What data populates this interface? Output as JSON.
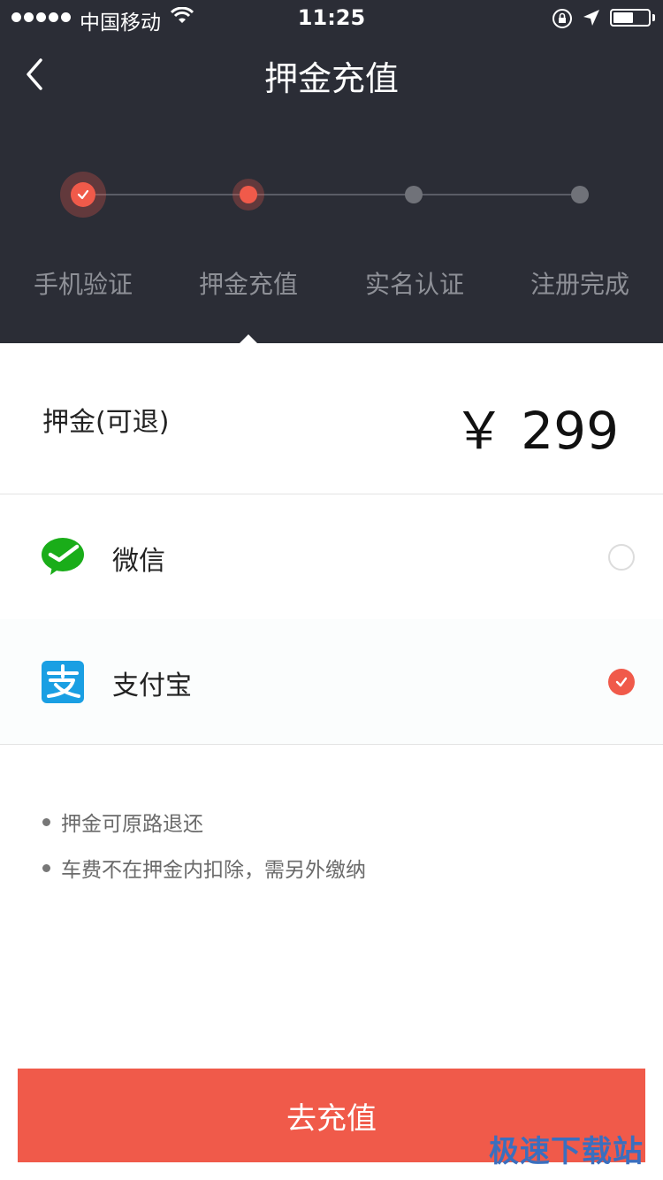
{
  "status_bar": {
    "carrier": "中国移动",
    "time": "11:25"
  },
  "nav": {
    "title": "押金充值"
  },
  "steps": [
    {
      "label": "手机验证",
      "state": "done"
    },
    {
      "label": "押金充值",
      "state": "current"
    },
    {
      "label": "实名认证",
      "state": "pending"
    },
    {
      "label": "注册完成",
      "state": "pending"
    }
  ],
  "deposit": {
    "label": "押金(可退)",
    "amount": "￥ 299"
  },
  "payment_methods": [
    {
      "name": "微信",
      "icon": "wechat-icon",
      "selected": false
    },
    {
      "name": "支付宝",
      "icon": "alipay-icon",
      "selected": true
    }
  ],
  "notes": [
    "押金可原路退还",
    "车费不在押金内扣除，需另外缴纳"
  ],
  "submit_label": "去充值",
  "watermark": "极速下载站",
  "colors": {
    "header_bg": "#2b2d36",
    "accent": "#f05a4a",
    "wechat_green": "#1aad19",
    "alipay_blue": "#1a9fe3",
    "inactive_step": "#8e9097"
  }
}
